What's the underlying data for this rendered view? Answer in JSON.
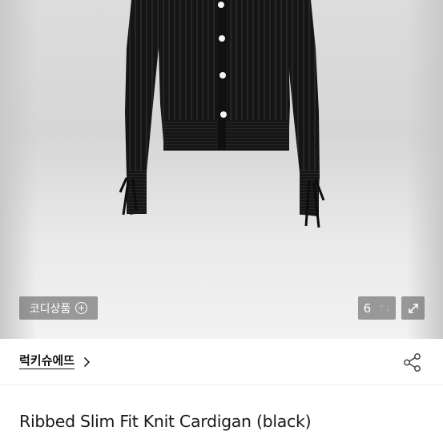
{
  "hero": {
    "coordi_label": "코디상품",
    "photo_count": "6",
    "sort_glyph": "↑↓"
  },
  "shop": {
    "name": "럭키슈에뜨"
  },
  "product": {
    "title": "Ribbed Slim Fit Knit Cardigan (black)"
  },
  "icons": {
    "coordi": "plus-circle-icon",
    "expand": "expand-arrows-icon",
    "shop_arrow": "chevron-right-icon",
    "share": "share-icon"
  },
  "colors": {
    "garment": "#141414",
    "button": "#f4f4f4",
    "overlay": "#505050"
  }
}
